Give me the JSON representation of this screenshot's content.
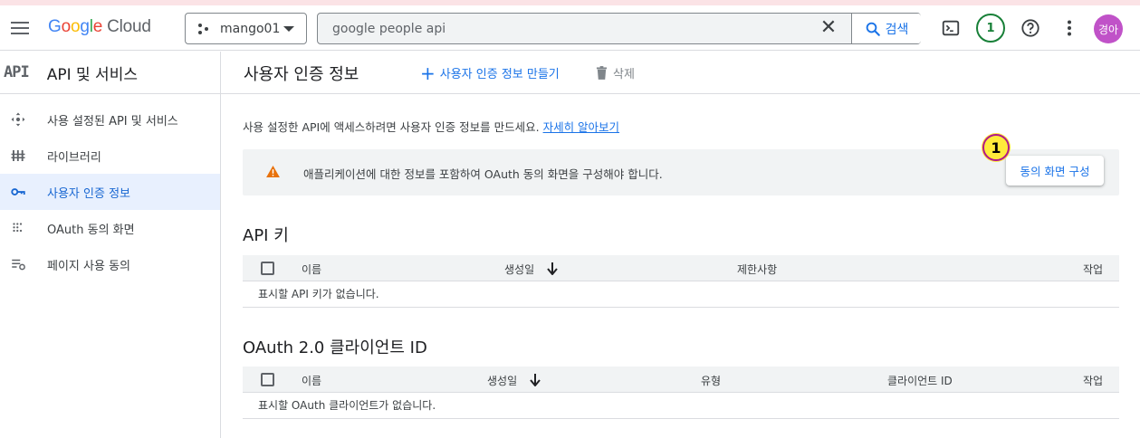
{
  "header": {
    "logo_google": [
      "G",
      "o",
      "o",
      "g",
      "l",
      "e"
    ],
    "logo_cloud": "Cloud",
    "project_name": "mango01",
    "search_value": "google people api",
    "search_button": "검색",
    "notification_count": "1",
    "avatar_text": "경아"
  },
  "sidebar": {
    "logo": "API",
    "title": "API 및 서비스",
    "items": [
      {
        "label": "사용 설정된 API 및 서비스",
        "icon": "apis-icon",
        "active": false
      },
      {
        "label": "라이브러리",
        "icon": "library-icon",
        "active": false
      },
      {
        "label": "사용자 인증 정보",
        "icon": "key-icon",
        "active": true
      },
      {
        "label": "OAuth 동의 화면",
        "icon": "consent-icon",
        "active": false
      },
      {
        "label": "페이지 사용 동의",
        "icon": "page-usage-icon",
        "active": false
      }
    ]
  },
  "main": {
    "title": "사용자 인증 정보",
    "create_label": "사용자 인증 정보 만들기",
    "delete_label": "삭제",
    "intro_text": "사용 설정한 API에 액세스하려면 사용자 인증 정보를 만드세요.",
    "intro_link": "자세히 알아보기",
    "alert_text": "애플리케이션에 대한 정보를 포함하여 OAuth 동의 화면을 구성해야 합니다.",
    "alert_button": "동의 화면 구성",
    "step_badge": "1",
    "api_keys": {
      "title": "API 키",
      "columns": [
        "이름",
        "생성일",
        "제한사항",
        "작업"
      ],
      "empty": "표시할 API 키가 없습니다."
    },
    "oauth": {
      "title": "OAuth 2.0 클라이언트 ID",
      "columns": [
        "이름",
        "생성일",
        "유형",
        "클라이언트 ID",
        "작업"
      ],
      "empty": "표시할 OAuth 클라이언트가 없습니다."
    }
  },
  "colors": {
    "accent": "#1a73e8",
    "warning": "#e8710a",
    "active_bg": "#e8f0fe",
    "badge_yellow": "#ffeb3b"
  }
}
